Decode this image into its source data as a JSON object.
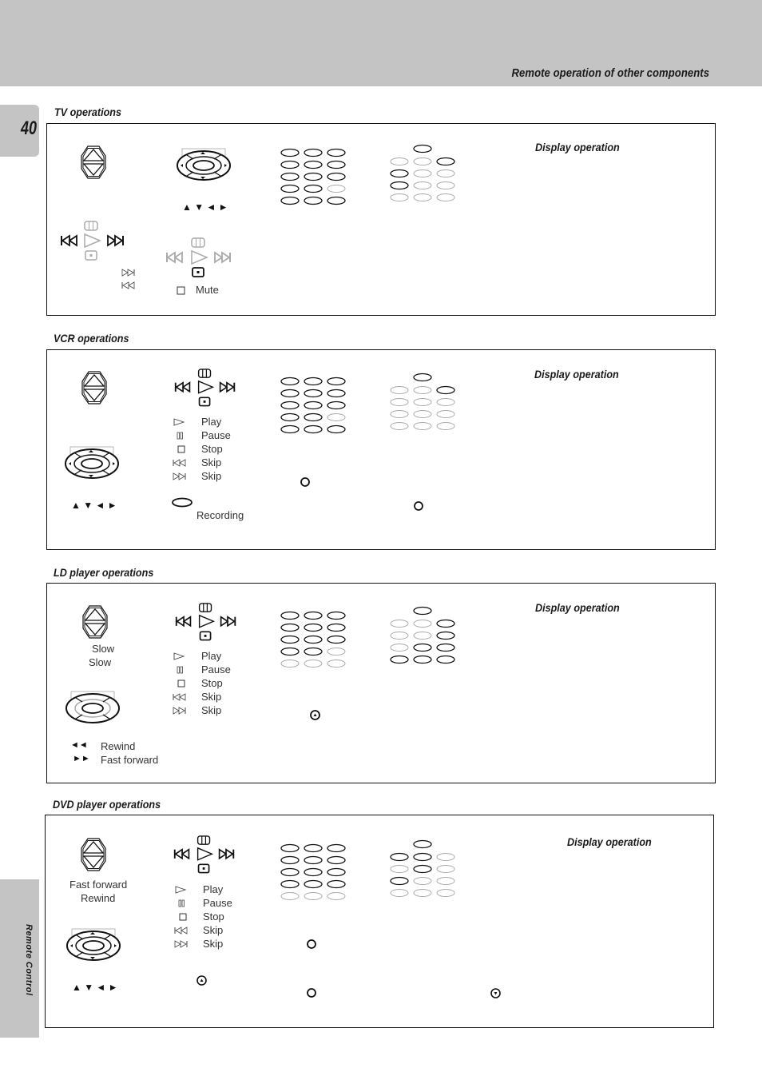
{
  "header": {
    "title": "Remote operation of other components"
  },
  "page_number": "40",
  "side_tab": {
    "label": "Remote Control"
  },
  "display_operation_label": "Display operation",
  "sections": {
    "tv": {
      "title": "TV  operations",
      "arrow_glyphs": "▲ ▼ ◄ ►",
      "mute_label": "Mute",
      "keypad_left": [
        [
          1,
          1,
          1
        ],
        [
          1,
          1,
          1
        ],
        [
          1,
          1,
          1
        ],
        [
          1,
          1,
          0
        ],
        [
          1,
          1,
          1
        ]
      ],
      "keypad_right_top": 1,
      "keypad_right": [
        [
          0,
          0,
          1
        ],
        [
          1,
          0,
          0
        ],
        [
          1,
          0,
          0
        ],
        [
          0,
          0,
          0
        ]
      ]
    },
    "vcr": {
      "title": "VCR operations",
      "legend": [
        {
          "icon": "play-icon",
          "label": "Play"
        },
        {
          "icon": "pause-icon",
          "label": "Pause"
        },
        {
          "icon": "stop-icon",
          "label": "Stop"
        },
        {
          "icon": "skip-back-icon",
          "label": "Skip"
        },
        {
          "icon": "skip-forward-icon",
          "label": "Skip"
        }
      ],
      "recording_label": "Recording",
      "arrow_glyphs": "▲ ▼ ◄ ►",
      "keypad_left": [
        [
          1,
          1,
          1
        ],
        [
          1,
          1,
          1
        ],
        [
          1,
          1,
          1
        ],
        [
          1,
          1,
          0
        ],
        [
          1,
          1,
          1
        ]
      ],
      "keypad_right_top": 1,
      "keypad_right": [
        [
          0,
          0,
          1
        ],
        [
          0,
          0,
          0
        ],
        [
          0,
          0,
          0
        ],
        [
          0,
          0,
          0
        ]
      ]
    },
    "ld": {
      "title": "LD player operations",
      "slow_labels": [
        "Slow",
        "Slow"
      ],
      "legend": [
        {
          "icon": "play-icon",
          "label": "Play"
        },
        {
          "icon": "pause-icon",
          "label": "Pause"
        },
        {
          "icon": "stop-icon",
          "label": "Stop"
        },
        {
          "icon": "skip-back-icon",
          "label": "Skip"
        },
        {
          "icon": "skip-forward-icon",
          "label": "Skip"
        }
      ],
      "rewind_label": "Rewind",
      "fast_forward_label": "Fast forward",
      "rewind_glyph": "◄◄",
      "fast_forward_glyph": "►►",
      "keypad_left": [
        [
          1,
          1,
          1
        ],
        [
          1,
          1,
          1
        ],
        [
          1,
          1,
          1
        ],
        [
          1,
          1,
          0
        ],
        [
          0,
          0,
          0
        ]
      ],
      "keypad_right_top": 1,
      "keypad_right": [
        [
          0,
          0,
          1
        ],
        [
          0,
          0,
          1
        ],
        [
          0,
          1,
          1
        ],
        [
          1,
          1,
          1
        ]
      ]
    },
    "dvd": {
      "title": "DVD player operations",
      "ff_rew_labels": [
        "Fast forward",
        "Rewind"
      ],
      "legend": [
        {
          "icon": "play-icon",
          "label": "Play"
        },
        {
          "icon": "pause-icon",
          "label": "Pause"
        },
        {
          "icon": "stop-icon",
          "label": "Stop"
        },
        {
          "icon": "skip-back-icon",
          "label": "Skip"
        },
        {
          "icon": "skip-forward-icon",
          "label": "Skip"
        }
      ],
      "arrow_glyphs": "▲ ▼ ◄ ►",
      "keypad_left": [
        [
          1,
          1,
          1
        ],
        [
          1,
          1,
          1
        ],
        [
          1,
          1,
          1
        ],
        [
          1,
          1,
          1
        ],
        [
          0,
          0,
          0
        ]
      ],
      "keypad_right_top": 1,
      "keypad_right": [
        [
          1,
          1,
          0
        ],
        [
          0,
          1,
          0
        ],
        [
          1,
          0,
          0
        ],
        [
          0,
          0,
          0
        ]
      ]
    }
  },
  "colors": {
    "header_bg": "#c4c4c4",
    "active_key": "#111111",
    "inactive_key": "#aaaaaa"
  }
}
